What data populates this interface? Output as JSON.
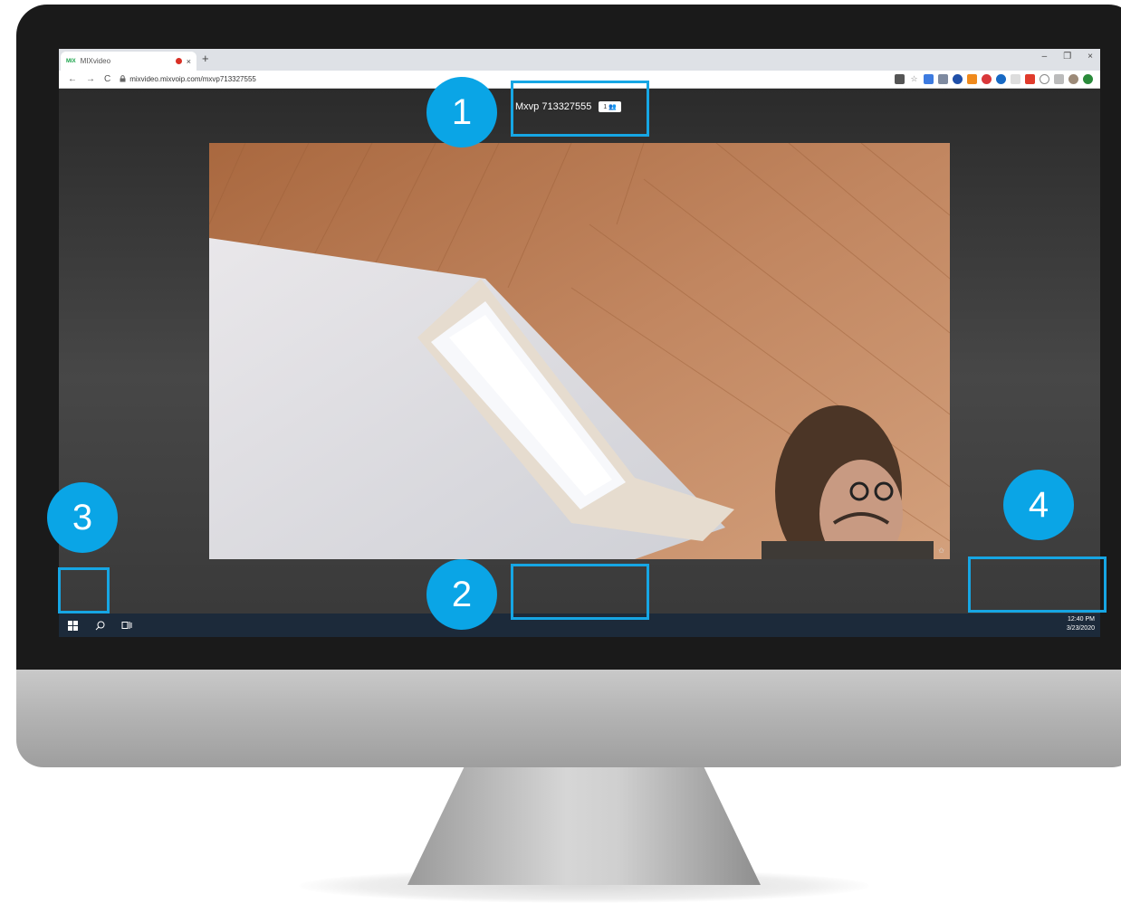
{
  "browser": {
    "tab_favicon": "MIX",
    "tab_title": "MIXvideo",
    "tab_close": "×",
    "new_tab": "+",
    "window_controls": {
      "minimize": "–",
      "restore": "❐",
      "close": "×"
    },
    "nav": {
      "back": "←",
      "forward": "→",
      "reload": "C"
    },
    "url": "mixvideo.mixvoip.com/mxvp713327555"
  },
  "meeting": {
    "title": "Mxvp 713327555",
    "participants": "1 👥"
  },
  "controls": {
    "mic_icon": "microphone-icon",
    "hangup_icon": "hang-up-icon",
    "camera_icon": "camera-icon",
    "screen_share_icon": "screen-share-icon",
    "grid_icon": "grid-view-icon",
    "info_icon": "info-icon",
    "more_icon": "more-options-icon"
  },
  "taskbar": {
    "time": "12:40 PM",
    "date": "3/23/2020"
  },
  "annotations": [
    {
      "number": "1"
    },
    {
      "number": "2"
    },
    {
      "number": "3"
    },
    {
      "number": "4"
    }
  ],
  "colors": {
    "accent_annotation": "#0aa5e6",
    "hangup_red": "#d0271c",
    "taskbar": "#1c2a3a"
  }
}
